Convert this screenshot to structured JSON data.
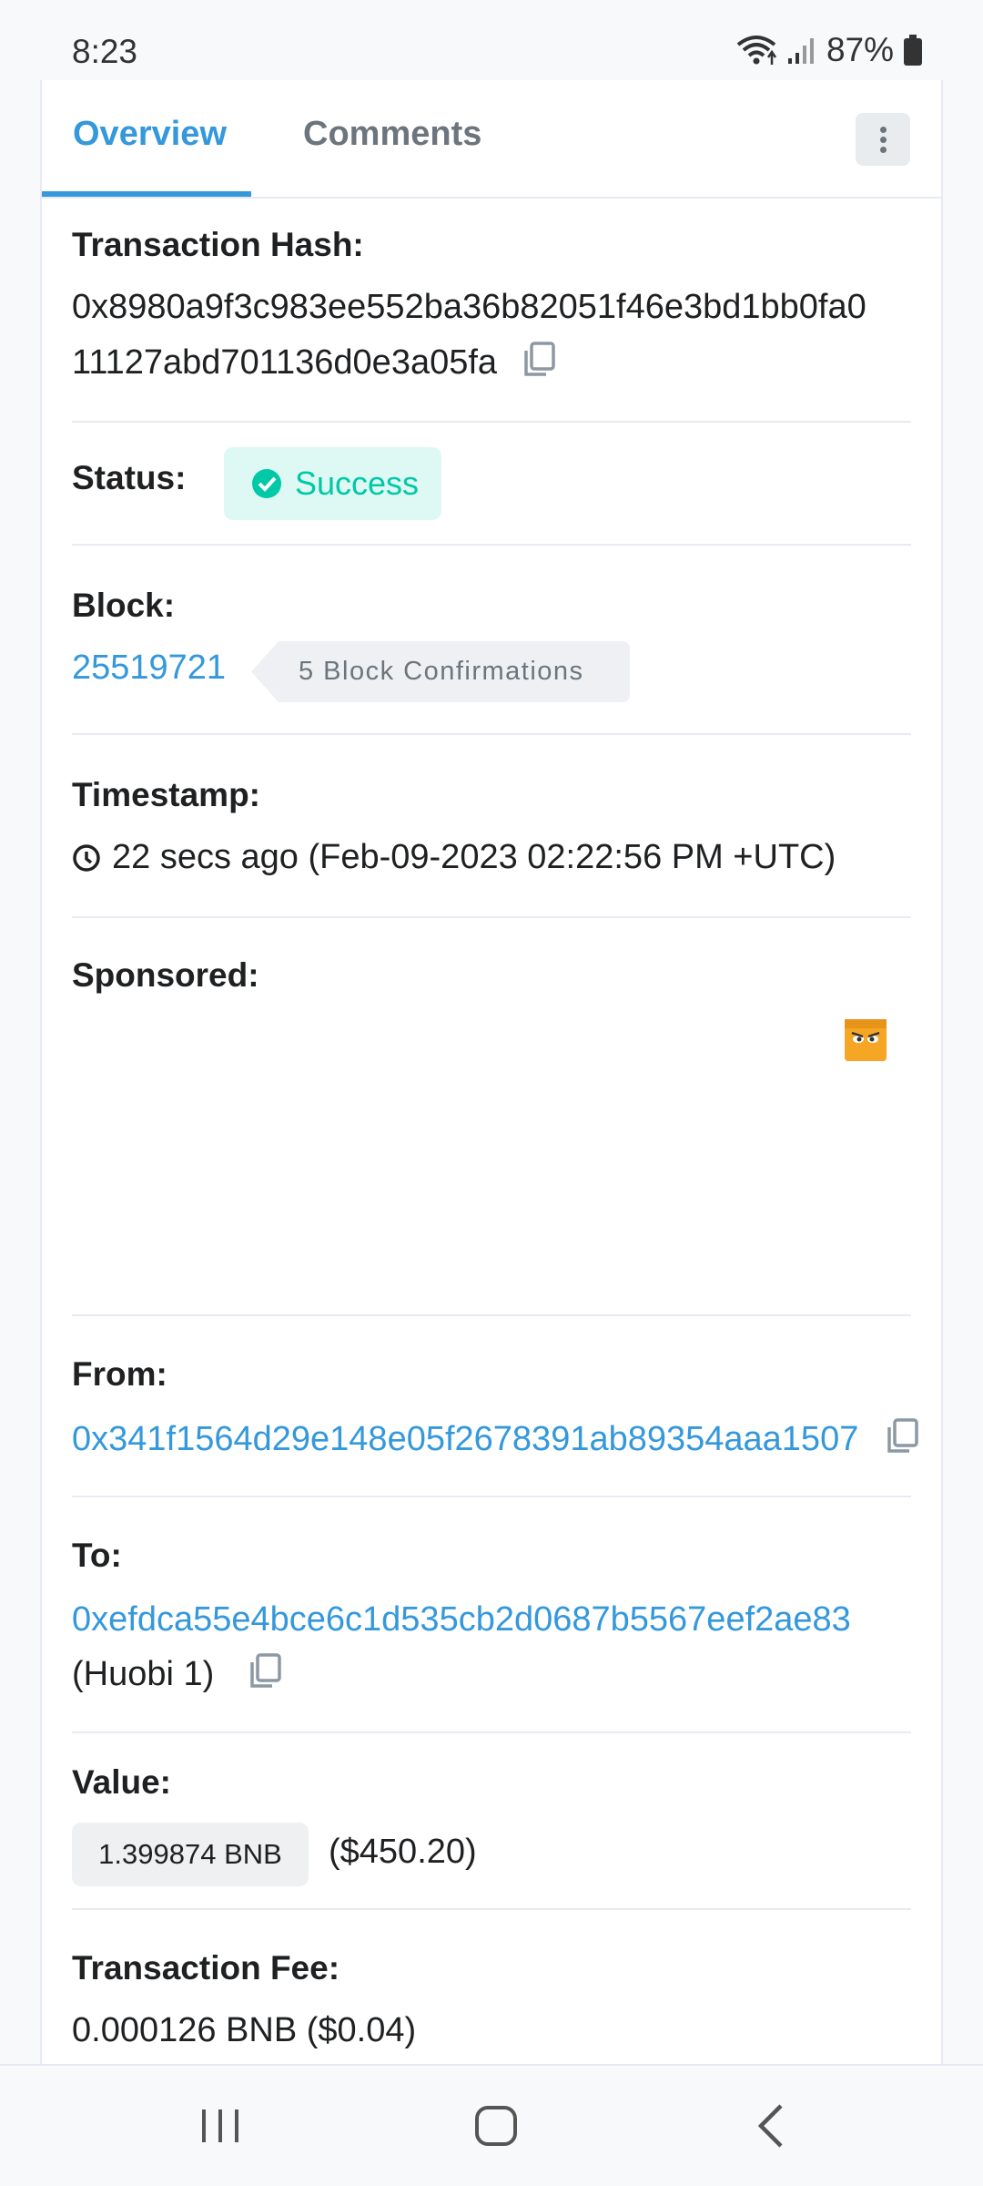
{
  "status_bar": {
    "time": "8:23",
    "battery": "87%",
    "icons": [
      "wifi-icon",
      "signal-icon",
      "battery-icon"
    ]
  },
  "tabs": [
    {
      "label": "Overview",
      "active": true
    },
    {
      "label": "Comments",
      "active": false
    }
  ],
  "transaction": {
    "hash_label": "Transaction Hash:",
    "hash_line1": "0x8980a9f3c983ee552ba36b82051f46e3bd1bb0fa0",
    "hash_line2": "11127abd701136d0e3a05fa",
    "status_label": "Status:",
    "status_value": "Success",
    "block_label": "Block:",
    "block_number": "25519721",
    "block_confirmations": "5 Block Confirmations",
    "timestamp_label": "Timestamp:",
    "timestamp_value": "22 secs ago (Feb-09-2023 02:22:56 PM +UTC)",
    "sponsored_label": "Sponsored:",
    "from_label": "From:",
    "from_address": "0x341f1564d29e148e05f2678391ab89354aaa1507",
    "to_label": "To:",
    "to_address": "0xefdca55e4bce6c1d535cb2d0687b5567eef2ae83",
    "to_name": "(Huobi 1)",
    "value_label": "Value:",
    "value_bnb": "1.399874 BNB",
    "value_usd": "($450.20)",
    "fee_label": "Transaction Fee:",
    "fee_value": "0.000126 BNB ($0.04)"
  },
  "colors": {
    "accent": "#3498db",
    "success": "#00c9a7",
    "success_bg": "#def8f3"
  },
  "nav": [
    "recent-apps-icon",
    "home-icon",
    "back-icon"
  ]
}
